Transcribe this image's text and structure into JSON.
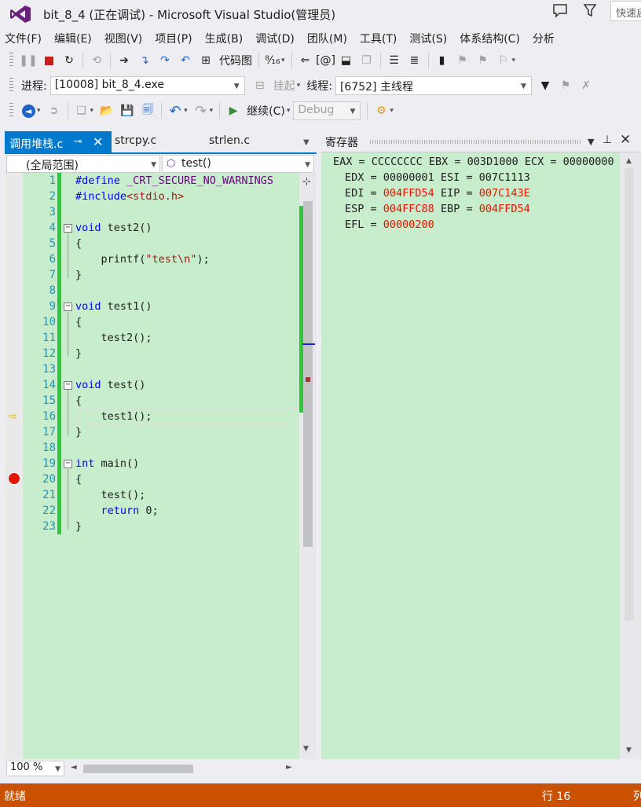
{
  "window": {
    "title": "bit_8_4 (正在调试) - Microsoft Visual Studio(管理员)",
    "quick_launch_placeholder": "快速启"
  },
  "menu": [
    "文件(F)",
    "编辑(E)",
    "视图(V)",
    "项目(P)",
    "生成(B)",
    "调试(D)",
    "团队(M)",
    "工具(T)",
    "测试(S)",
    "体系结构(C)",
    "分析"
  ],
  "toolbar1": {
    "code_map_label": "代码图"
  },
  "toolbar2": {
    "process_label": "进程:",
    "process_value": "[10008] bit_8_4.exe",
    "suspend_label": "挂起",
    "thread_label": "线程:",
    "thread_value": "[6752] 主线程"
  },
  "toolbar3": {
    "continue_label": "继续(C)",
    "config_value": "Debug"
  },
  "editor": {
    "tabs": [
      "调用堆栈.c",
      "strcpy.c",
      "strlen.c"
    ],
    "scope_value": "(全局范围)",
    "function_value": "test()",
    "zoom_value": "100 %",
    "line_numbers": [
      "1",
      "2",
      "3",
      "4",
      "5",
      "6",
      "7",
      "8",
      "9",
      "10",
      "11",
      "12",
      "13",
      "14",
      "15",
      "16",
      "17",
      "18",
      "19",
      "20",
      "21",
      "22",
      "23"
    ],
    "code": {
      "l1_kw": "#define",
      "l1_rest": " _CRT_SECURE_NO_WARNINGS",
      "l2_kw": "#include",
      "l2_rest": "<stdio.h>",
      "l4_kw": "void",
      "l4_rest": " test2()",
      "l5": "{",
      "l6_pre": "    printf(",
      "l6_str": "\"test\\n\"",
      "l6_post": ");",
      "l7": "}",
      "l9_kw": "void",
      "l9_rest": " test1()",
      "l10": "{",
      "l11": "    test2();",
      "l12": "}",
      "l14_kw": "void",
      "l14_rest": " test()",
      "l15": "{",
      "l16": "    test1();",
      "l17": "}",
      "l19_kw": "int",
      "l19_rest": " main()",
      "l20": "{",
      "l21": "    test();",
      "l22_pre": "    ",
      "l22_kw": "return",
      "l22_post": " 0;",
      "l23": "}"
    }
  },
  "registers": {
    "title": "寄存器",
    "r1": "EAX = CCCCCCCC EBX = 003D1000 ECX = 00000000",
    "r2": "EDX = 00000001 ESI = 007C1113",
    "r3a": "EDI = ",
    "r3b": "004FFD54",
    "r3c": " EIP = ",
    "r3d": "007C143E",
    "r4a": "ESP = ",
    "r4b": "004FFC88",
    "r4c": " EBP = ",
    "r4d": "004FFD54",
    "r5a": "EFL = ",
    "r5b": "00000200"
  },
  "status": {
    "text": "就绪",
    "line": "行 16",
    "col": "列"
  },
  "colors": {
    "accent": "#007acc",
    "status_bar": "#ca5100",
    "editor_bg": "#c7edcc",
    "changed_value": "#e51400",
    "breakpoint": "#e51400",
    "change_bar": "#28c840"
  }
}
